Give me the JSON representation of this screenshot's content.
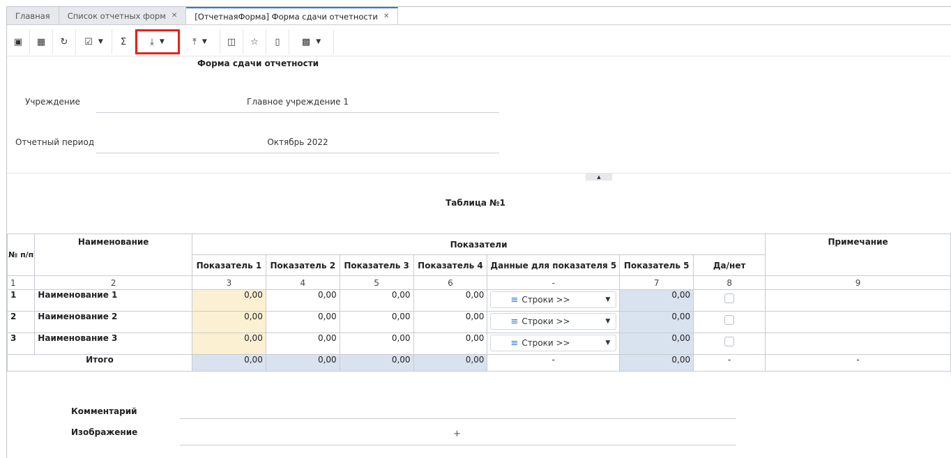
{
  "tabs": [
    {
      "label": "Главная",
      "closable": false,
      "active": false
    },
    {
      "label": "Список отчетных форм",
      "closable": true,
      "active": false
    },
    {
      "label": "[ОтчетнаяФорма] Форма сдачи отчетности",
      "closable": true,
      "active": true
    }
  ],
  "toolbar": {
    "buttons": [
      {
        "icon": "save-icon",
        "glyph": "🖫"
      },
      {
        "icon": "calculator-icon",
        "glyph": "▦"
      },
      {
        "icon": "refresh-icon",
        "glyph": "↻"
      },
      {
        "icon": "checklist-icon",
        "glyph": "☑≡",
        "dropdown": true
      },
      {
        "icon": "sum-icon",
        "glyph": "Σ"
      },
      {
        "icon": "download-icon",
        "glyph": "⤓",
        "dropdown": true,
        "highlighted": true
      },
      {
        "icon": "upload-icon",
        "glyph": "⤒",
        "dropdown": true
      },
      {
        "icon": "document-search-icon",
        "glyph": "🗎"
      },
      {
        "icon": "star-icon",
        "glyph": "☆"
      },
      {
        "icon": "monitor-icon",
        "glyph": "🖵"
      },
      {
        "icon": "print-icon",
        "glyph": "🖶",
        "dropdown": true
      }
    ],
    "highlight_color": "#e8201a"
  },
  "form": {
    "title": "Форма сдачи отчетности",
    "institution_label": "Учреждение",
    "institution_value": "Главное учреждение 1",
    "period_label": "Отчетный период",
    "period_value": "Октябрь 2022"
  },
  "table": {
    "title": "Таблица №1",
    "header": {
      "no": "№ п/п",
      "name": "Наименование",
      "indicators": "Показатели",
      "note": "Примечание",
      "sub": [
        "Показатель 1",
        "Показатель 2",
        "Показатель 3",
        "Показатель 4",
        "Данные для показателя 5",
        "Показатель 5",
        "Да/нет"
      ]
    },
    "numbers": [
      "1",
      "2",
      "3",
      "4",
      "5",
      "6",
      "-",
      "7",
      "8",
      "9"
    ],
    "rows": [
      {
        "no": "1",
        "name": "Наименование 1",
        "p1": "0,00",
        "p2": "0,00",
        "p3": "0,00",
        "p4": "0,00",
        "dd": "Строки >>",
        "p5": "0,00",
        "checked": false,
        "note": ""
      },
      {
        "no": "2",
        "name": "Наименование 2",
        "p1": "0,00",
        "p2": "0,00",
        "p3": "0,00",
        "p4": "0,00",
        "dd": "Строки >>",
        "p5": "0,00",
        "checked": false,
        "note": ""
      },
      {
        "no": "3",
        "name": "Наименование 3",
        "p1": "0,00",
        "p2": "0,00",
        "p3": "0,00",
        "p4": "0,00",
        "dd": "Строки >>",
        "p5": "0,00",
        "checked": false,
        "note": ""
      }
    ],
    "total": {
      "label": "Итого",
      "p1": "0,00",
      "p2": "0,00",
      "p3": "0,00",
      "p4": "0,00",
      "dd": "-",
      "p5": "0,00",
      "yn": "-",
      "note": "-"
    }
  },
  "footer": {
    "comment_label": "Комментарий",
    "image_label": "Изображение",
    "add_symbol": "+"
  },
  "colors": {
    "accent": "#2f7bd3",
    "editable_cell": "#fcf0d2",
    "computed_cell": "#d9e3ef"
  }
}
